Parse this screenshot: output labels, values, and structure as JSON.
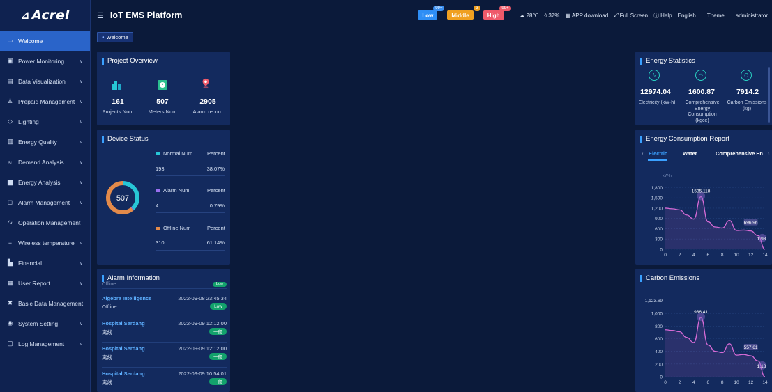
{
  "app": {
    "logo": "Acrel",
    "title": "IoT EMS Platform"
  },
  "header": {
    "tags": [
      {
        "label": "Low",
        "count": "99+",
        "color": "#2e8ef5",
        "count_color": "#3b8ff0"
      },
      {
        "label": "Middle",
        "count": "3",
        "color": "#f0a021",
        "count_color": "#f0a021"
      },
      {
        "label": "High",
        "count": "99+",
        "color": "#ef5a6a",
        "count_color": "#ef5a6a"
      }
    ],
    "temperature": "28℃",
    "humidity": "37%",
    "app_download": "APP download",
    "full_screen": "Full Screen",
    "help": "Help",
    "language": "English",
    "theme": "Theme",
    "user": "administrator"
  },
  "breadcrumb": {
    "label": "Welcome"
  },
  "sidebar": {
    "items": [
      {
        "label": "Welcome",
        "icon": "monitor-icon",
        "active": true
      },
      {
        "label": "Power Monitoring",
        "icon": "power-monitor-icon"
      },
      {
        "label": "Data Visualization",
        "icon": "dashboard-icon"
      },
      {
        "label": "Prepaid Management",
        "icon": "users-icon"
      },
      {
        "label": "Lighting",
        "icon": "bulb-icon"
      },
      {
        "label": "Energy Quality",
        "icon": "quality-icon"
      },
      {
        "label": "Demand Analysis",
        "icon": "pulse-icon"
      },
      {
        "label": "Energy Analysis",
        "icon": "bar-chart-icon"
      },
      {
        "label": "Alarm Management",
        "icon": "alarm-icon"
      },
      {
        "label": "Operation Management",
        "icon": "wave-icon"
      },
      {
        "label": "Wireless temperature",
        "icon": "thermometer-icon"
      },
      {
        "label": "Financial",
        "icon": "finance-icon"
      },
      {
        "label": "User Report",
        "icon": "report-icon"
      },
      {
        "label": "Basic Data Management",
        "icon": "settings-tool-icon"
      },
      {
        "label": "System Setting",
        "icon": "gear-icon"
      },
      {
        "label": "Log Management",
        "icon": "log-icon"
      }
    ]
  },
  "project_overview": {
    "title": "Project Overview",
    "stats": [
      {
        "value": "161",
        "label": "Projects Num"
      },
      {
        "value": "507",
        "label": "Meters Num"
      },
      {
        "value": "2905",
        "label": "Alarm record"
      }
    ]
  },
  "device_status": {
    "title": "Device Status",
    "total": "507",
    "percent_header": "Percent",
    "rows": [
      {
        "label": "Normal Num",
        "value": "193",
        "percent": "38.07%",
        "color": "#27c6d6",
        "fraction": 0.3807
      },
      {
        "label": "Alarm Num",
        "value": "4",
        "percent": "0.79%",
        "color": "#9a6ff0",
        "fraction": 0.0079
      },
      {
        "label": "Offline Num",
        "value": "310",
        "percent": "61.14%",
        "color": "#e38a4a",
        "fraction": 0.6114
      }
    ]
  },
  "alarm_information": {
    "title": "Alarm Information",
    "partial_top": "Offline",
    "partial_badge": "Low",
    "items": [
      {
        "name": "Algebra Intelligence",
        "time": "2022-09-08 23:45:34",
        "status": "Offline",
        "badge": "Low"
      },
      {
        "name": "Hospital Serdang",
        "time": "2022-09-09 12:12:00",
        "status": "离线",
        "badge": "一般"
      },
      {
        "name": "Hospital Serdang",
        "time": "2022-09-09 12:12:00",
        "status": "离线",
        "badge": "一般"
      },
      {
        "name": "Hospital Serdang",
        "time": "2022-09-09 10:54:01",
        "status": "离线",
        "badge": "一般"
      }
    ]
  },
  "energy_statistics": {
    "title": "Energy Statistics",
    "items": [
      {
        "value": "12974.04",
        "label": "Electricity (kW·h)",
        "icon": "lightning-icon"
      },
      {
        "value": "1600.87",
        "label": "Comprehensive Energy Consumption (kgce)",
        "icon": "gauge-icon"
      },
      {
        "value": "7914.2",
        "label": "Carbon Emissions (kg)",
        "icon": "carbon-icon"
      }
    ]
  },
  "energy_consumption_report": {
    "title": "Energy Consumption Report",
    "tabs": [
      "Electric",
      "Water",
      "Comprehensive En"
    ]
  },
  "carbon_emissions": {
    "title": "Carbon Emissions"
  },
  "chart_data": [
    {
      "type": "line",
      "title": "Energy Consumption Report",
      "ylabel": "kW·h",
      "x": [
        0,
        1,
        2,
        3,
        4,
        5,
        6,
        7,
        8,
        9,
        10,
        11,
        12,
        13,
        14
      ],
      "xticks": [
        "0",
        "2",
        "4",
        "6",
        "8",
        "10",
        "12",
        "14"
      ],
      "yticks": [
        "0",
        "300",
        "600",
        "900",
        "1,200",
        "1,500",
        "1,800"
      ],
      "ylim": [
        0,
        1950
      ],
      "values": [
        1200,
        1180,
        1150,
        1000,
        880,
        1535.118,
        800,
        650,
        620,
        840,
        550,
        560,
        535,
        400,
        1.93
      ],
      "annotations": [
        "1535.118",
        "696.96",
        "1.93"
      ],
      "color": "#d66bd6"
    },
    {
      "type": "line",
      "title": "Carbon Emissions",
      "x": [
        0,
        1,
        2,
        3,
        4,
        5,
        6,
        7,
        8,
        9,
        10,
        11,
        12,
        13,
        14
      ],
      "xticks": [
        "0",
        "2",
        "4",
        "6",
        "8",
        "10",
        "12",
        "14"
      ],
      "yticks": [
        "0",
        "200",
        "400",
        "600",
        "800",
        "1,000"
      ],
      "top_label": "1,123.69",
      "ylim": [
        0,
        1200
      ],
      "values": [
        740,
        730,
        710,
        620,
        540,
        936.41,
        500,
        400,
        380,
        520,
        340,
        350,
        330,
        250,
        1.18
      ],
      "annotations": [
        "936.41",
        "557.61",
        "1.18"
      ],
      "color": "#d66bd6"
    }
  ]
}
